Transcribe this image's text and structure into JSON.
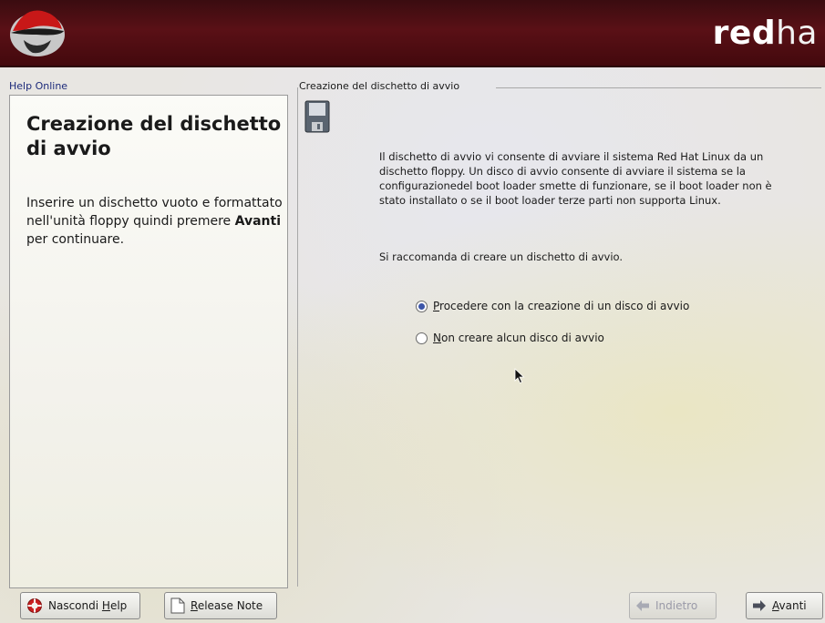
{
  "banner": {
    "brand_bold": "red",
    "brand_light": "ha",
    "logo_icon": "redhat-shadowman-icon"
  },
  "help": {
    "group_title": "Help Online",
    "heading": "Creazione del dischetto di avvio",
    "body_pre": "Inserire un dischetto vuoto e formattato nell'unità floppy quindi premere ",
    "body_bold": "Avanti",
    "body_post": " per continuare."
  },
  "content": {
    "group_title": "Creazione del dischetto di avvio",
    "icon": "floppy-disk-icon",
    "paragraph1": "Il dischetto di avvio vi consente di avviare il sistema Red Hat Linux da un dischetto floppy. Un disco di avvio consente di avviare il sistema se la configurazionedel boot loader smette di funzionare, se il boot loader non è stato installato o se il boot loader terze parti non supporta Linux.",
    "paragraph2": "Si raccomanda di creare un dischetto di avvio.",
    "options": [
      {
        "mnemonic": "P",
        "rest": "rocedere con la creazione di un disco di avvio",
        "selected": true
      },
      {
        "mnemonic": "N",
        "rest": "on creare alcun disco di avvio",
        "selected": false
      }
    ]
  },
  "buttons": {
    "hide_help": {
      "pre": "Nascondi ",
      "mnemonic": "H",
      "post": "elp",
      "icon": "lifebuoy-icon"
    },
    "release_notes": {
      "mnemonic": "R",
      "post": "elease Note",
      "icon": "document-icon"
    },
    "back": {
      "label": "Indietro",
      "icon": "arrow-left-icon",
      "enabled": false
    },
    "next": {
      "mnemonic": "A",
      "post": "vanti",
      "icon": "arrow-right-icon"
    }
  }
}
